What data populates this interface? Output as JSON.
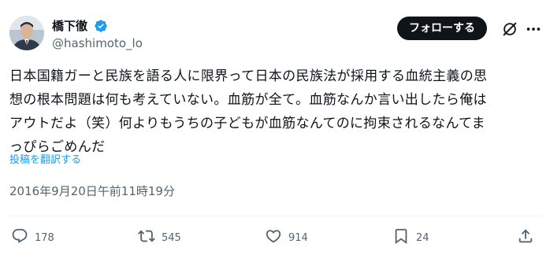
{
  "user": {
    "display_name": "橋下徹",
    "handle": "@hashimoto_lo"
  },
  "header": {
    "follow_label": "フォローする"
  },
  "tweet": {
    "text": "日本国籍ガーと民族を語る人に限界って日本の民族法が採用する血統主義の思\n想の根本問題は何も考えていない。血筋が全て。血筋なんか言い出したら俺は\nアウトだよ（笑）何よりもうちの子どもが血筋なんてのに拘束されるなんてま\nっぴらごめんだ",
    "translate_label": "投稿を翻訳する",
    "timestamp": "2016年9月20日午前11時19分"
  },
  "actions": {
    "replies": "178",
    "reposts": "545",
    "likes": "914",
    "bookmarks": "24"
  },
  "colors": {
    "verified": "#1d9bf0",
    "link": "#1d9bf0",
    "muted": "#536471",
    "text": "#0f1419"
  }
}
